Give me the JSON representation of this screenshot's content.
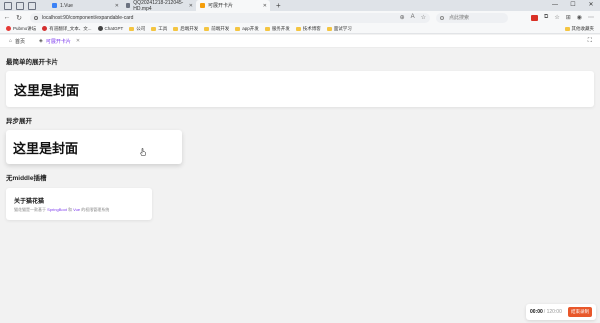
{
  "browser": {
    "tabs": [
      {
        "label": "1.Vue",
        "fav_color": "#3b82f6"
      },
      {
        "label": "QQ20241218-212045-HD.mp4",
        "fav_color": "#6b7280"
      },
      {
        "label": "可展开卡片",
        "fav_color": "#f59e0b"
      }
    ],
    "url": "localhost:90/component/expandable-card",
    "search_placeholder": "点此搜索",
    "bookmarks": [
      "Pubmo讲坛",
      "有道翻译_文本、文...",
      "ChatGPT",
      "公司",
      "工具",
      "后端开发",
      "前端开发",
      "app开发",
      "服务开发",
      "技术博客",
      "面试学习"
    ],
    "bookmarks_right": "其他收藏夹"
  },
  "app_tabs": {
    "home": "首页",
    "current": "可展开卡片"
  },
  "sections": {
    "s1_title": "最简单的展开卡片",
    "s1_cover": "这里是封面",
    "s2_title": "异步展开",
    "s2_cover": "这里是封面",
    "s3_title": "无middle插槽",
    "s3_card_title": "关于猫花猫",
    "s3_card_desc_1": "猫花猫是一款基于 ",
    "s3_card_desc_hl1": "SpringBoot",
    "s3_card_desc_2": " 和 ",
    "s3_card_desc_hl2": "Vue",
    "s3_card_desc_3": " 的权限管理系统"
  },
  "recorder": {
    "time": "00:00",
    "total": "/ 120:00",
    "stop_label": "结束录制"
  },
  "colors": {
    "accent": "#7c3aed",
    "record": "#e8572a"
  }
}
